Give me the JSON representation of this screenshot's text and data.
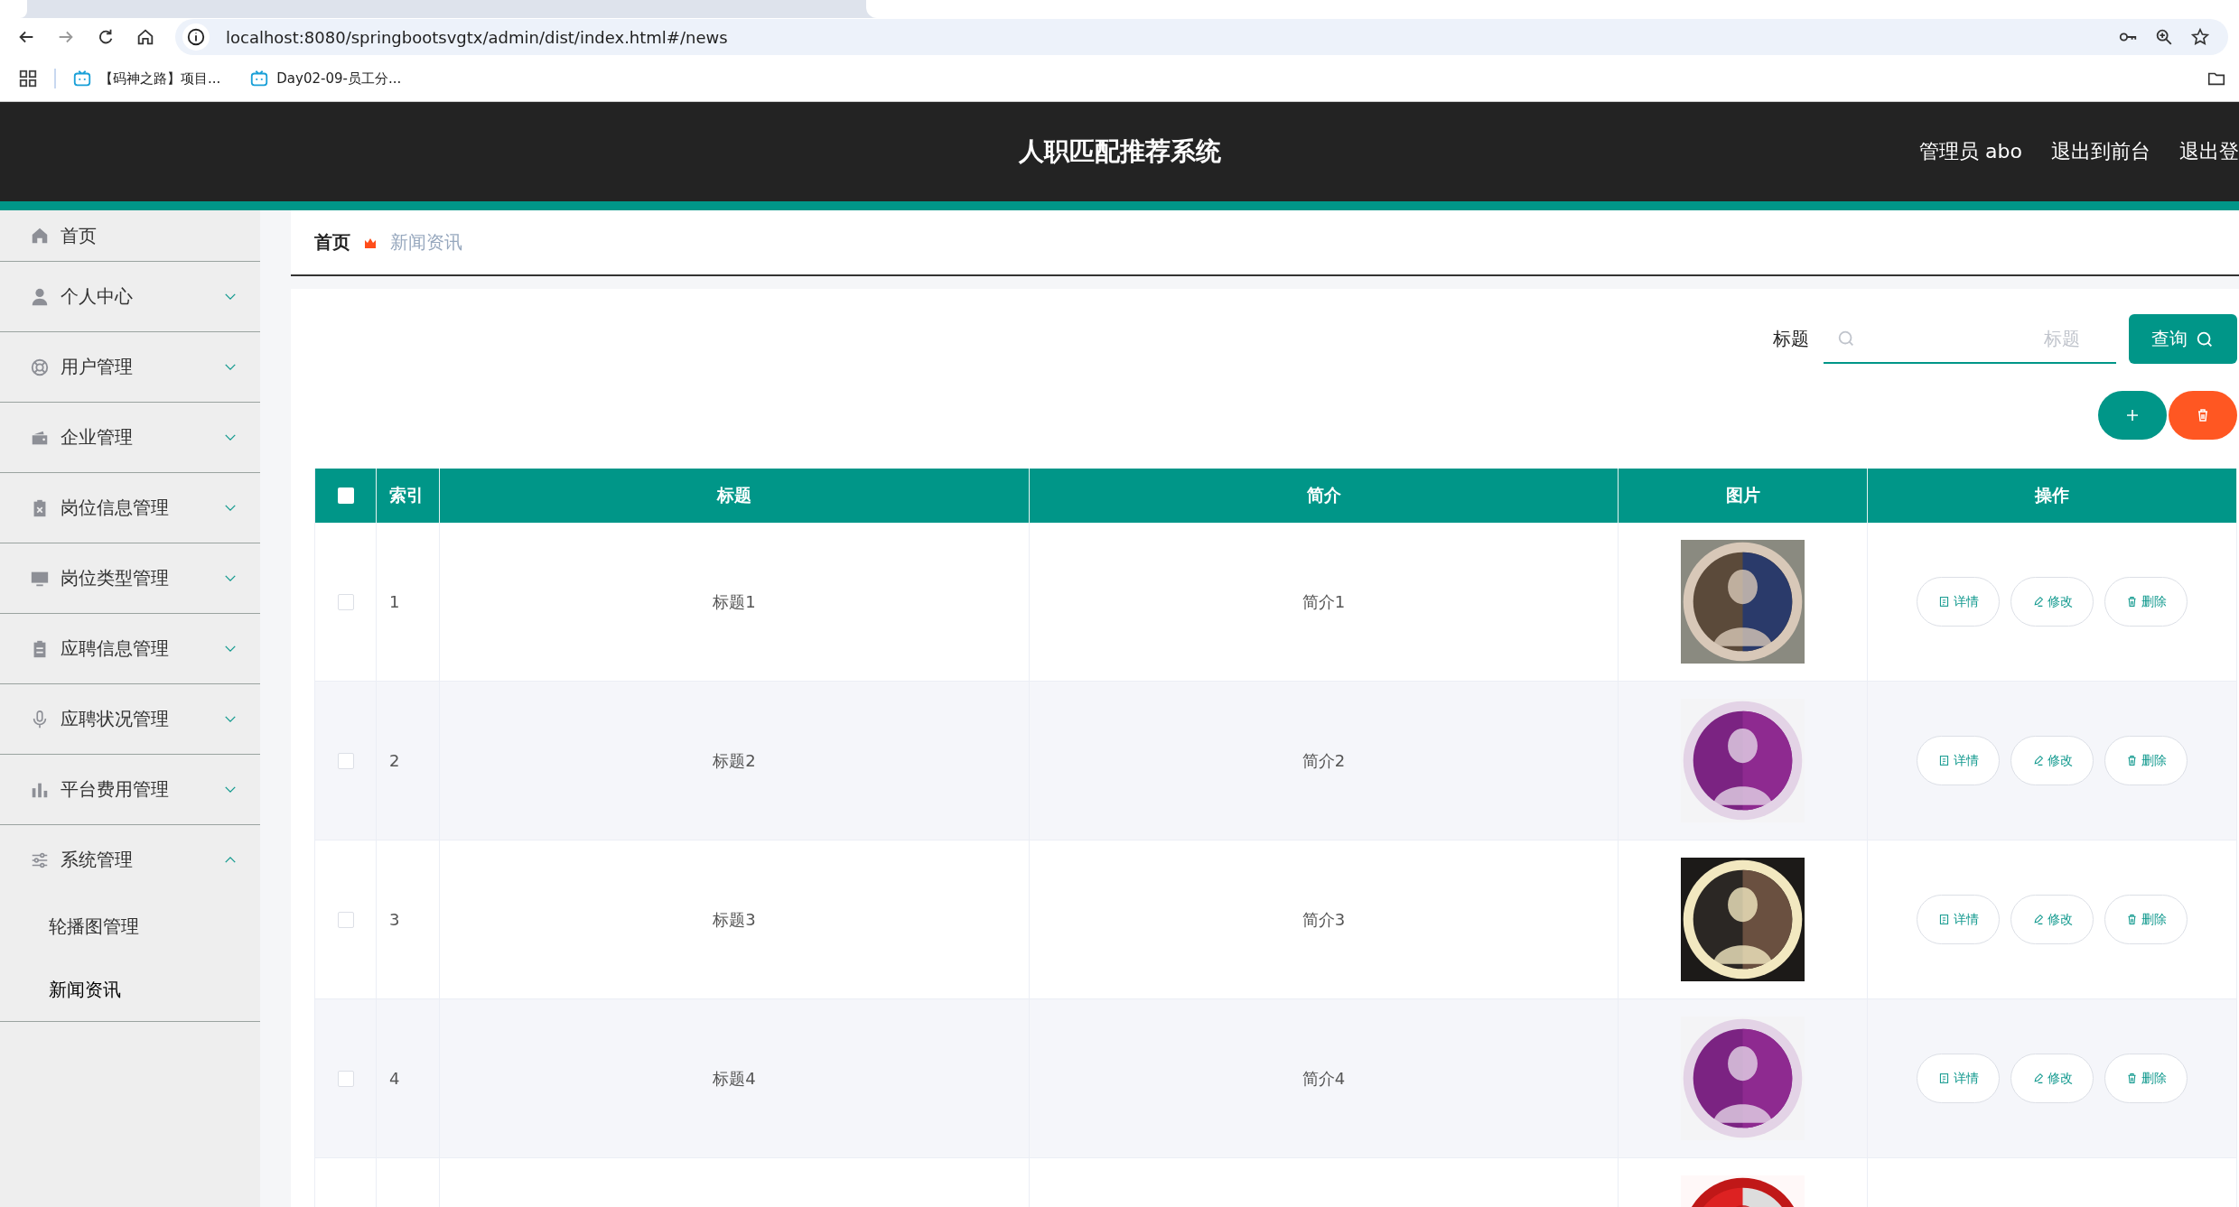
{
  "browser": {
    "url": "localhost:8080/springbootsvgtx/admin/dist/index.html#/news",
    "bookmarks": [
      "【码神之路】项目...",
      "Day02-09-员工分..."
    ]
  },
  "header": {
    "title": "人职匹配推荐系统",
    "links": [
      "管理员 abo",
      "退出到前台",
      "退出登"
    ]
  },
  "sidebar": {
    "items": [
      {
        "label": "首页"
      },
      {
        "label": "个人中心",
        "expanded": false
      },
      {
        "label": "用户管理",
        "expanded": false
      },
      {
        "label": "企业管理",
        "expanded": false
      },
      {
        "label": "岗位信息管理",
        "expanded": false
      },
      {
        "label": "岗位类型管理",
        "expanded": false
      },
      {
        "label": "应聘信息管理",
        "expanded": false
      },
      {
        "label": "应聘状况管理",
        "expanded": false
      },
      {
        "label": "平台费用管理",
        "expanded": false
      },
      {
        "label": "系统管理",
        "expanded": true,
        "children": [
          {
            "label": "轮播图管理",
            "selected": false
          },
          {
            "label": "新闻资讯",
            "selected": true
          }
        ]
      }
    ]
  },
  "breadcrumb": [
    "首页",
    "新闻资讯"
  ],
  "search": {
    "label": "标题",
    "placeholder": "标题",
    "button": "查询"
  },
  "table": {
    "columns": [
      "索引",
      "标题",
      "简介",
      "图片",
      "操作"
    ],
    "all_checked": false,
    "rows": [
      {
        "checked": false,
        "index": "1",
        "title": "标题1",
        "intro": "简介1",
        "image": {
          "kind": "picture"
        },
        "actions": [
          "详情",
          "修改",
          "删除"
        ]
      },
      {
        "checked": false,
        "index": "2",
        "title": "标题2",
        "intro": "简介2",
        "image": {
          "kind": "picture"
        },
        "actions": [
          "详情",
          "修改",
          "删除"
        ]
      },
      {
        "checked": false,
        "index": "3",
        "title": "标题3",
        "intro": "简介3",
        "image": {
          "kind": "picture"
        },
        "actions": [
          "详情",
          "修改",
          "删除"
        ]
      },
      {
        "checked": false,
        "index": "4",
        "title": "标题4",
        "intro": "简介4",
        "image": {
          "kind": "picture"
        },
        "actions": [
          "详情",
          "修改",
          "删除"
        ]
      },
      {
        "image": {
          "kind": "picture"
        }
      }
    ]
  }
}
